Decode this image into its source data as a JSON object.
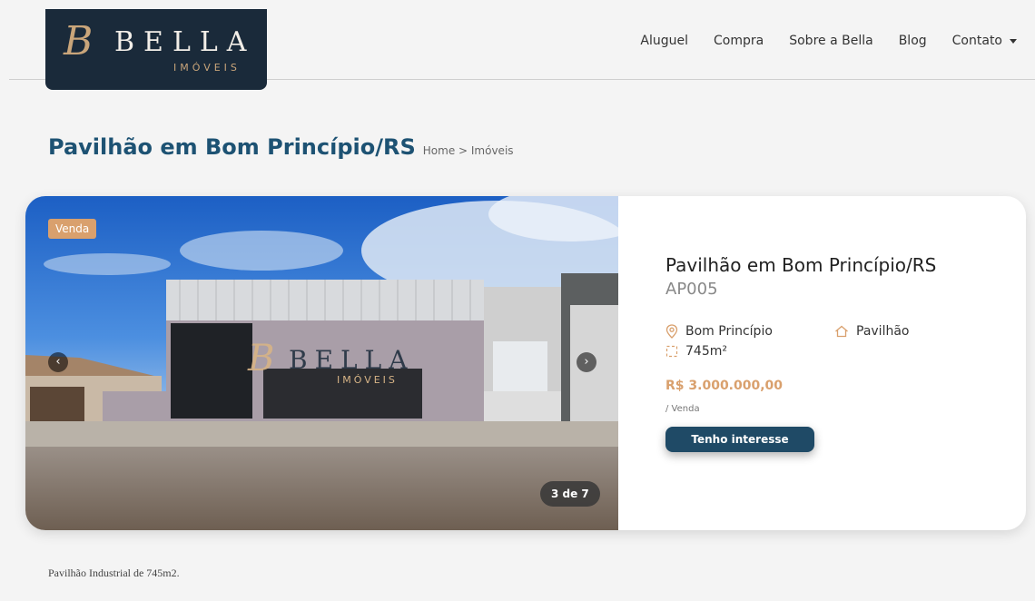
{
  "header": {
    "logo_mark": "B",
    "logo_word": "BELLA",
    "logo_sub": "IMÓVEIS",
    "nav": [
      "Aluguel",
      "Compra",
      "Sobre a Bella",
      "Blog",
      "Contato"
    ]
  },
  "page": {
    "title": "Pavilhão em Bom Princípio/RS",
    "breadcrumb": "Home > Imóveis"
  },
  "listing": {
    "badge": "Venda",
    "photo_counter": "3 de 7",
    "watermark_word": "BELLA",
    "watermark_sub": "IMÓVEIS",
    "title": "Pavilhão em Bom Princípio/RS",
    "code": "AP005",
    "city": "Bom Princípio",
    "type": "Pavilhão",
    "area": "745m²",
    "price": "R$ 3.000.000,00",
    "price_suffix": "/ Venda",
    "cta": "Tenho interesse"
  },
  "description": "Pavilhão Industrial de 745m2.",
  "colors": {
    "brand_navy": "#1a2a3a",
    "accent_gold": "#d9a06d",
    "title_blue": "#1d5273"
  },
  "icons": [
    "location-pin-icon",
    "house-icon",
    "area-icon",
    "chevron-left-icon",
    "chevron-right-icon",
    "caret-down-icon"
  ]
}
